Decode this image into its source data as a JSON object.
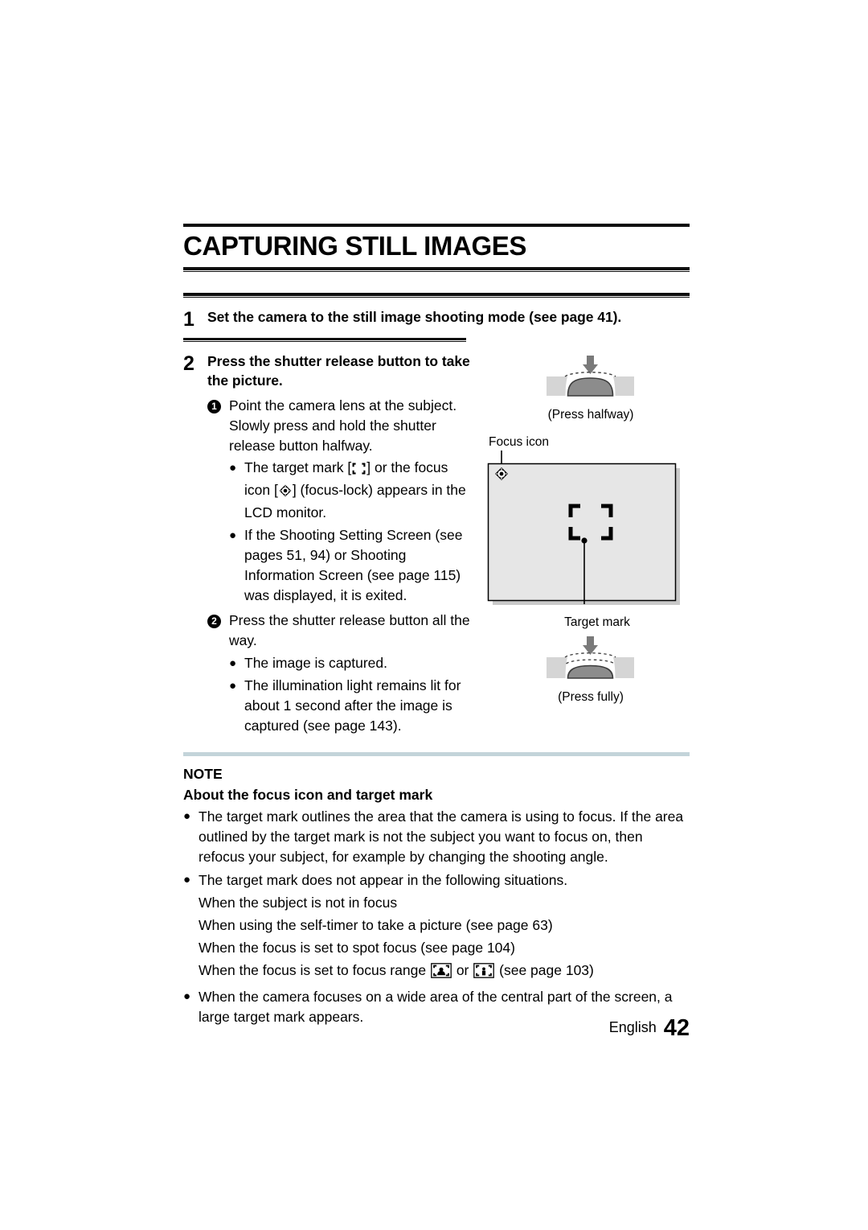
{
  "page": {
    "title": "CAPTURING STILL IMAGES",
    "footer_language": "English",
    "footer_page_number": "42"
  },
  "colors": {
    "rule": "#0d0d0d",
    "note_bar": "#c3d4d9",
    "lcd_screen": "#e6e6e6",
    "shutter_button": "#8c8c8c",
    "shutter_body": "#d5d5d5",
    "shadow": "#c9c9c9"
  },
  "steps": [
    {
      "number": "1",
      "title": "Set the camera to the still image shooting mode (see page 41)."
    },
    {
      "number": "2",
      "title": "Press the shutter release button to take the picture.",
      "substeps": [
        {
          "marker": "1",
          "text_before_icons": "Point the camera lens at the subject. Slowly press and hold the shutter release button halfway.",
          "bullets": [
            {
              "part1": "The target mark [",
              "icon1": "target-mark-icon",
              "part2": "] or the focus icon [",
              "icon2": "focus-lock-icon",
              "part3": "] (focus-lock) appears in the LCD monitor."
            },
            {
              "part1": "If the Shooting Setting Screen (see pages 51, 94) or Shooting Information Screen (see page 115) was displayed, it is exited."
            }
          ]
        },
        {
          "marker": "2",
          "text_before_icons": "Press the shutter release button all the way.",
          "bullets": [
            {
              "part1": "The image is captured."
            },
            {
              "part1": "The illumination light remains lit for about 1 second after the image is captured (see page 143)."
            }
          ]
        }
      ]
    }
  ],
  "figures": {
    "press_halfway_caption": "(Press halfway)",
    "press_fully_caption": "(Press fully)",
    "focus_icon_label": "Focus icon",
    "target_mark_label": "Target mark"
  },
  "note": {
    "label": "NOTE",
    "subtitle": "About the focus icon and target mark",
    "bullets": [
      "The target mark outlines the area that the camera is using to focus. If the area outlined by the target mark is not the subject you want to focus on, then refocus your subject, for example by changing the shooting angle.",
      "The target mark does not appear in the following situations.",
      "When the camera focuses on a wide area of the central part of the screen, a large target mark appears."
    ],
    "situations": [
      "When the subject is not in focus",
      "When using the self-timer to take a picture (see page 63)",
      "When the focus is set to spot focus (see page 104)"
    ],
    "focus_range_line": {
      "prefix": "When the focus is set to focus range",
      "icon1": "focus-range-wide-icon",
      "middle": "or",
      "icon2": "focus-range-spot-icon",
      "suffix": "(see page 103)"
    }
  }
}
